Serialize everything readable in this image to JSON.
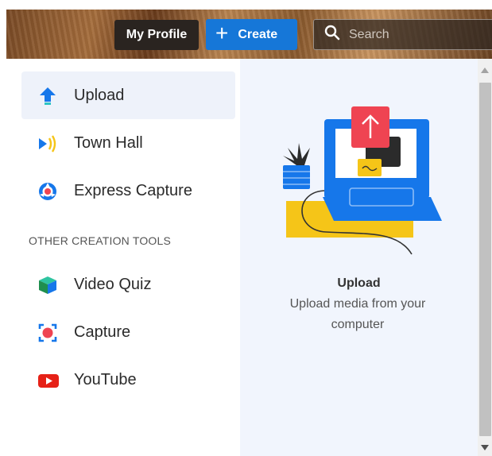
{
  "header": {
    "profile_label": "My Profile",
    "create_label": "Create",
    "search_placeholder": "Search"
  },
  "menu": {
    "items": [
      {
        "label": "Upload",
        "icon": "upload-arrow-icon",
        "selected": true
      },
      {
        "label": "Town Hall",
        "icon": "broadcast-icon",
        "selected": false
      },
      {
        "label": "Express Capture",
        "icon": "express-capture-icon",
        "selected": false
      }
    ],
    "section_label": "OTHER CREATION TOOLS",
    "other_items": [
      {
        "label": "Video Quiz",
        "icon": "cube-icon"
      },
      {
        "label": "Capture",
        "icon": "record-icon"
      },
      {
        "label": "YouTube",
        "icon": "youtube-icon"
      }
    ]
  },
  "preview": {
    "title": "Upload",
    "description": "Upload media from your computer"
  },
  "colors": {
    "accent": "#1677d8",
    "selected_bg": "#eef2fa",
    "preview_bg": "#f1f5fd",
    "upload_red": "#ef4452",
    "laptop_blue": "#1677ea",
    "yellow": "#f5c518"
  }
}
